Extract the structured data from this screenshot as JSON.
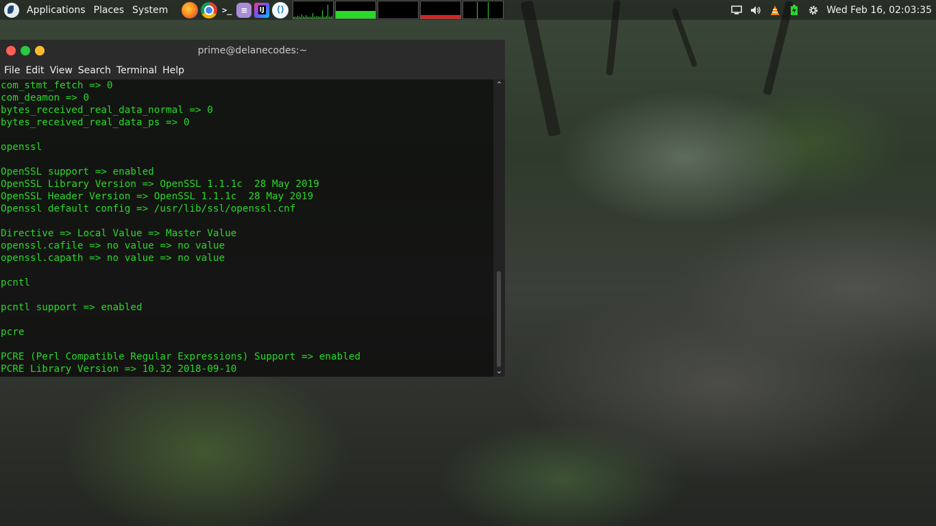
{
  "panel": {
    "menus": [
      "Applications",
      "Places",
      "System"
    ],
    "clock": "Wed Feb 16, 02:03:35"
  },
  "launchers": [
    {
      "name": "firefox-icon"
    },
    {
      "name": "chrome-icon"
    },
    {
      "name": "terminal-icon",
      "glyph": ">_"
    },
    {
      "name": "text-editor-icon",
      "glyph": "≡"
    },
    {
      "name": "intellij-icon",
      "glyph": "IJ"
    },
    {
      "name": "vscode-icon",
      "glyph": "⟨⟩"
    }
  ],
  "system_monitors": [
    {
      "name": "cpu-monitor",
      "color": "#29d829"
    },
    {
      "name": "memory-monitor",
      "color": "#29d829"
    },
    {
      "name": "network-monitor",
      "color": "#d0d0d0"
    },
    {
      "name": "swap-monitor",
      "color": "#e02020"
    },
    {
      "name": "disk-monitor",
      "color": "#29d829"
    }
  ],
  "tray_icons": [
    "display-icon",
    "volume-icon",
    "vlc-icon",
    "battery-icon",
    "settings-icon"
  ],
  "terminal": {
    "title": "prime@delanecodes:~",
    "menu": [
      "File",
      "Edit",
      "View",
      "Search",
      "Terminal",
      "Help"
    ],
    "text_color": "#29d829",
    "lines": [
      "com_stmt_fetch => 0",
      "com_deamon => 0",
      "bytes_received_real_data_normal => 0",
      "bytes_received_real_data_ps => 0",
      "",
      "openssl",
      "",
      "OpenSSL support => enabled",
      "OpenSSL Library Version => OpenSSL 1.1.1c  28 May 2019",
      "OpenSSL Header Version => OpenSSL 1.1.1c  28 May 2019",
      "Openssl default config => /usr/lib/ssl/openssl.cnf",
      "",
      "Directive => Local Value => Master Value",
      "openssl.cafile => no value => no value",
      "openssl.capath => no value => no value",
      "",
      "pcntl",
      "",
      "pcntl support => enabled",
      "",
      "pcre",
      "",
      "PCRE (Perl Compatible Regular Expressions) Support => enabled",
      "PCRE Library Version => 10.32 2018-09-10"
    ]
  }
}
